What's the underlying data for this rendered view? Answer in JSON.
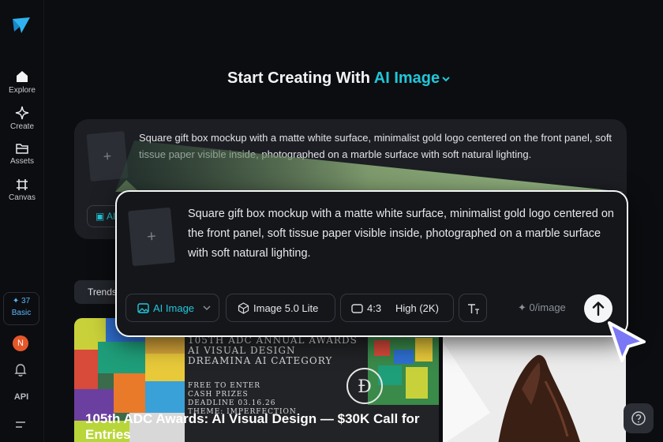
{
  "sidebar": {
    "nav": [
      {
        "label": "Explore",
        "icon": "home-icon"
      },
      {
        "label": "Create",
        "icon": "sparkle-icon"
      },
      {
        "label": "Assets",
        "icon": "folder-icon"
      },
      {
        "label": "Canvas",
        "icon": "canvas-icon"
      }
    ],
    "credits": {
      "count": "37",
      "plan": "Basic"
    },
    "avatar_letter": "N",
    "api_label": "API"
  },
  "header": {
    "prefix": "Start Creating With",
    "mode": "AI Image"
  },
  "prompt": {
    "text": "Square gift box mockup with a matte white surface, minimalist gold logo centered on the front panel, soft tissue paper visible inside, photographed on a marble surface with soft natural lighting.",
    "bg_chip_label": "AI"
  },
  "toolbar": {
    "mode_label": "AI Image",
    "model_label": "Image 5.0 Lite",
    "ratio_label": "4:3",
    "quality_label": "High (2K)",
    "cost_label": "0/image"
  },
  "tabs": {
    "trends_label": "Trends"
  },
  "gallery": {
    "poster_lines": [
      "105TH ADC ANNUAL AWARDS",
      "AI VISUAL DESIGN",
      "DREAMINA AI CATEGORY"
    ],
    "poster_small_lines": [
      "FREE TO ENTER",
      "CASH PRIZES",
      "DEADLINE 03.16.26",
      "THEME: IMPERFECTION"
    ],
    "feature_title": "105th ADC Awards: AI Visual Design — $30K Call for Entries"
  },
  "colors": {
    "accent": "#21c7d9",
    "credits": "#5ab8ff",
    "cursor": "#7b78f5",
    "avatar": "#e5572b"
  }
}
